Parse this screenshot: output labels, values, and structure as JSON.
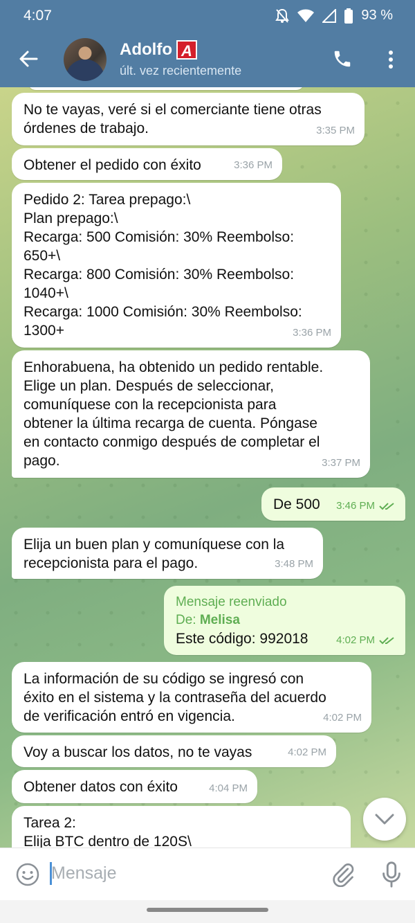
{
  "status_bar": {
    "time": "4:07",
    "battery": "93 %"
  },
  "contact": {
    "name": "Adolfo",
    "badge_letter": "A",
    "last_seen": "últ. vez recientemente"
  },
  "colors": {
    "header": "#527da3",
    "incoming_bubble": "#ffffff",
    "outgoing_bubble": "#effdde",
    "accent_green": "#5fae53"
  },
  "messages": [
    {
      "dir": "in",
      "lines": [
        "No te vayas, veré si el comerciante tiene otras",
        "órdenes de trabajo."
      ],
      "time": "3:35 PM"
    },
    {
      "dir": "in",
      "lines": [
        "Obtener el pedido con éxito"
      ],
      "time": "3:36 PM"
    },
    {
      "dir": "in",
      "lines": [
        "Pedido 2: Tarea prepago:\\",
        "Plan prepago:\\",
        "Recarga: 500 Comisión: 30% Reembolso:",
        "650+\\",
        "Recarga: 800 Comisión: 30% Reembolso:",
        "1040+\\",
        "Recarga: 1000 Comisión: 30% Reembolso:",
        "1300+"
      ],
      "time": "3:36 PM"
    },
    {
      "dir": "in",
      "lines": [
        "Enhorabuena, ha obtenido un pedido rentable.",
        "Elige un plan. Después de seleccionar,",
        "comuníquese con la recepcionista para",
        "obtener la última recarga de cuenta. Póngase",
        "en contacto conmigo después de completar el",
        "pago."
      ],
      "time": "3:37 PM"
    },
    {
      "dir": "out",
      "lines": [
        "De 500"
      ],
      "time": "3:46 PM"
    },
    {
      "dir": "in",
      "lines": [
        "Elija un buen plan y comuníquese con la",
        "recepcionista para el pago."
      ],
      "time": "3:48 PM"
    },
    {
      "dir": "out",
      "forward_label": "Mensaje reenviado",
      "forward_prefix": "De:",
      "forward_from": "Melisa",
      "lines": [
        "Este código: 992018"
      ],
      "time": "4:02 PM"
    },
    {
      "dir": "in",
      "lines": [
        "La información de su código se ingresó con",
        "éxito en el sistema y la contraseña del acuerdo",
        "de verificación entró en vigencia."
      ],
      "time": "4:02 PM"
    },
    {
      "dir": "in",
      "lines": [
        "Voy a buscar los datos, no te vayas"
      ],
      "time": "4:02 PM"
    },
    {
      "dir": "in",
      "lines": [
        "Obtener datos con éxito"
      ],
      "time": "4:04 PM"
    },
    {
      "dir": "in",
      "lines": [
        "Tarea 2:",
        "Elija BTC dentro de 120S\\"
      ],
      "time": ""
    }
  ],
  "input": {
    "placeholder": "Mensaje"
  }
}
